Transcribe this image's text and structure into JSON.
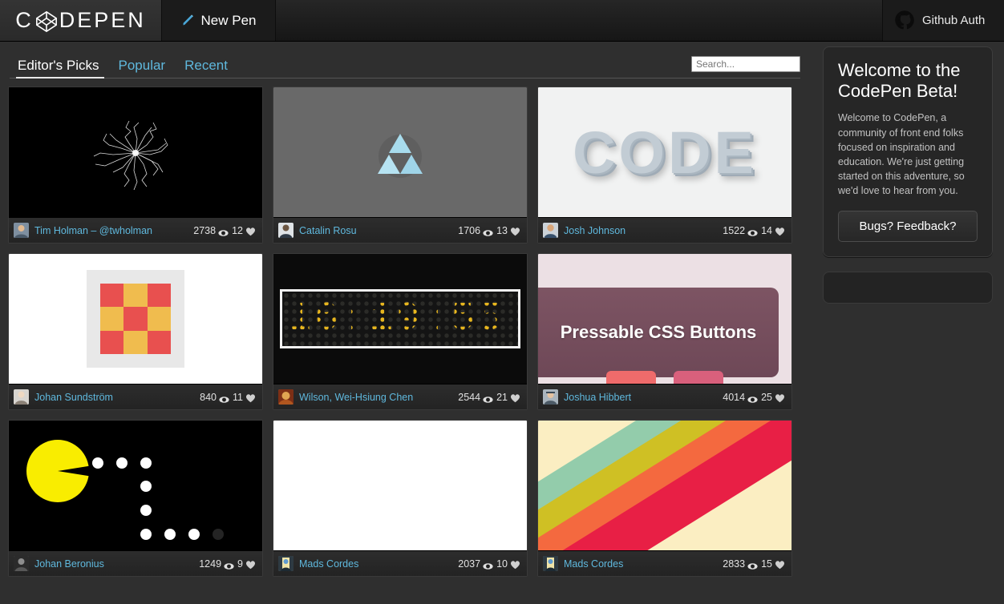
{
  "header": {
    "logo_text": "CODEPEN",
    "logo_icon": "codepen-logo-icon",
    "new_pen_label": "New Pen",
    "new_pen_icon": "pencil-icon",
    "github_auth_label": "Github Auth",
    "github_icon": "github-octocat-icon"
  },
  "tabs": [
    {
      "label": "Editor's Picks",
      "active": true
    },
    {
      "label": "Popular",
      "active": false
    },
    {
      "label": "Recent",
      "active": false
    }
  ],
  "search": {
    "placeholder": "Search...",
    "value": ""
  },
  "sidebar": {
    "welcome_title": "Welcome to the CodePen Beta!",
    "welcome_body": "Welcome to CodePen, a community of front end folks focused on inspiration and education. We're just getting started on this adventure, so we'd love to hear from you.",
    "feedback_button": "Bugs? Feedback?"
  },
  "pens": [
    {
      "author": "Tim Holman – @twholman",
      "views": "2738",
      "loves": "12",
      "art": "scribble"
    },
    {
      "author": "Catalin Rosu",
      "views": "1706",
      "loves": "13",
      "art": "triforce"
    },
    {
      "author": "Josh Johnson",
      "views": "1522",
      "loves": "14",
      "art": "code",
      "art_text": "CODE"
    },
    {
      "author": "Johan Sundström",
      "views": "840",
      "loves": "11",
      "art": "squares"
    },
    {
      "author": "Wilson, Wei-Hsiung Chen",
      "views": "2544",
      "loves": "21",
      "art": "led",
      "art_text": "16:19:55"
    },
    {
      "author": "Joshua Hibbert",
      "views": "4014",
      "loves": "25",
      "art": "pressable",
      "art_text": "Pressable CSS Buttons"
    },
    {
      "author": "Johan Beronius",
      "views": "1249",
      "loves": "9",
      "art": "pacman"
    },
    {
      "author": "Mads Cordes",
      "views": "2037",
      "loves": "10",
      "art": "blank-white"
    },
    {
      "author": "Mads Cordes",
      "views": "2833",
      "loves": "15",
      "art": "stripes"
    }
  ],
  "icons": {
    "eye": "eye-icon",
    "heart": "heart-icon"
  },
  "colors": {
    "accent_link": "#5fb8dd",
    "page_bg": "#2f2f2f",
    "card_bg": "#191919",
    "header_bg": "#1e1e1e"
  }
}
